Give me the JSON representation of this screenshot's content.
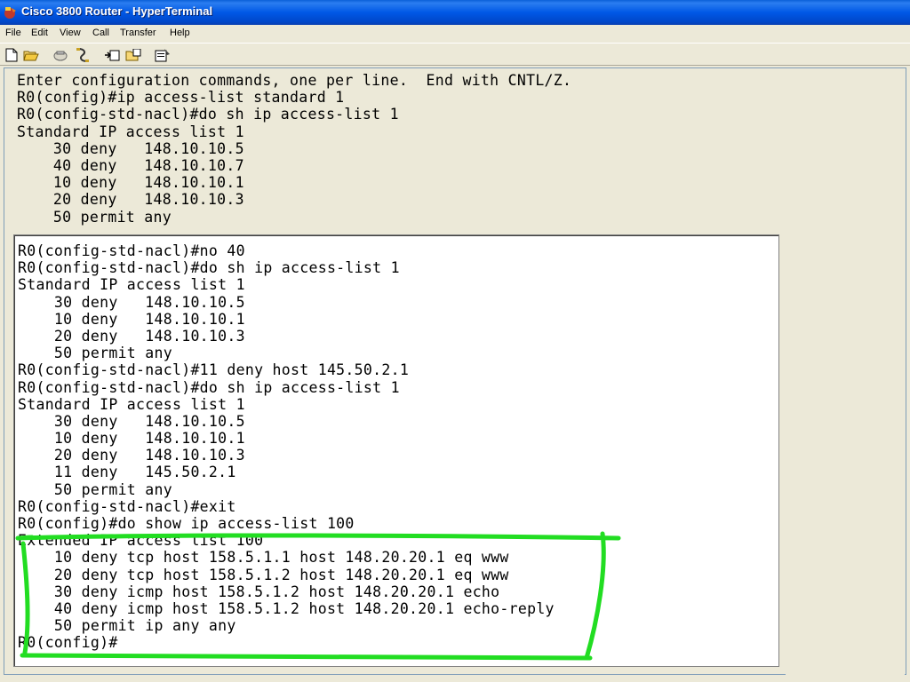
{
  "window": {
    "title": "Cisco 3800 Router - HyperTerminal",
    "menu": [
      "File",
      "Edit",
      "View",
      "Call",
      "Transfer",
      "Help"
    ],
    "toolbar_icons": [
      "new-document-icon",
      "open-folder-icon",
      "phone-icon",
      "disconnect-icon",
      "send-icon",
      "receive-icon",
      "properties-icon"
    ]
  },
  "terminal": {
    "top_lines": [
      "Enter configuration commands, one per line.  End with CNTL/Z.",
      "R0(config)#ip access-list standard 1",
      "R0(config-std-nacl)#do sh ip access-list 1",
      "Standard IP access list 1",
      "    30 deny   148.10.10.5",
      "    40 deny   148.10.10.7",
      "    10 deny   148.10.10.1",
      "    20 deny   148.10.10.3",
      "    50 permit any"
    ],
    "panel_lines": [
      "R0(config-std-nacl)#no 40",
      "R0(config-std-nacl)#do sh ip access-list 1",
      "Standard IP access list 1",
      "    30 deny   148.10.10.5",
      "    10 deny   148.10.10.1",
      "    20 deny   148.10.10.3",
      "    50 permit any",
      "R0(config-std-nacl)#11 deny host 145.50.2.1",
      "R0(config-std-nacl)#do sh ip access-list 1",
      "Standard IP access list 1",
      "    30 deny   148.10.10.5",
      "    10 deny   148.10.10.1",
      "    20 deny   148.10.10.3",
      "    11 deny   145.50.2.1",
      "    50 permit any",
      "R0(config-std-nacl)#exit",
      "R0(config)#do show ip access-list 100",
      "Extended IP access list 100",
      "    10 deny tcp host 158.5.1.1 host 148.20.20.1 eq www",
      "    20 deny tcp host 158.5.1.2 host 148.20.20.1 eq www",
      "    30 deny icmp host 158.5.1.2 host 148.20.20.1 echo",
      "    40 deny icmp host 158.5.1.2 host 148.20.20.1 echo-reply",
      "    50 permit ip any any",
      "R0(config)#"
    ]
  },
  "annotation": {
    "color": "#22dd22"
  }
}
